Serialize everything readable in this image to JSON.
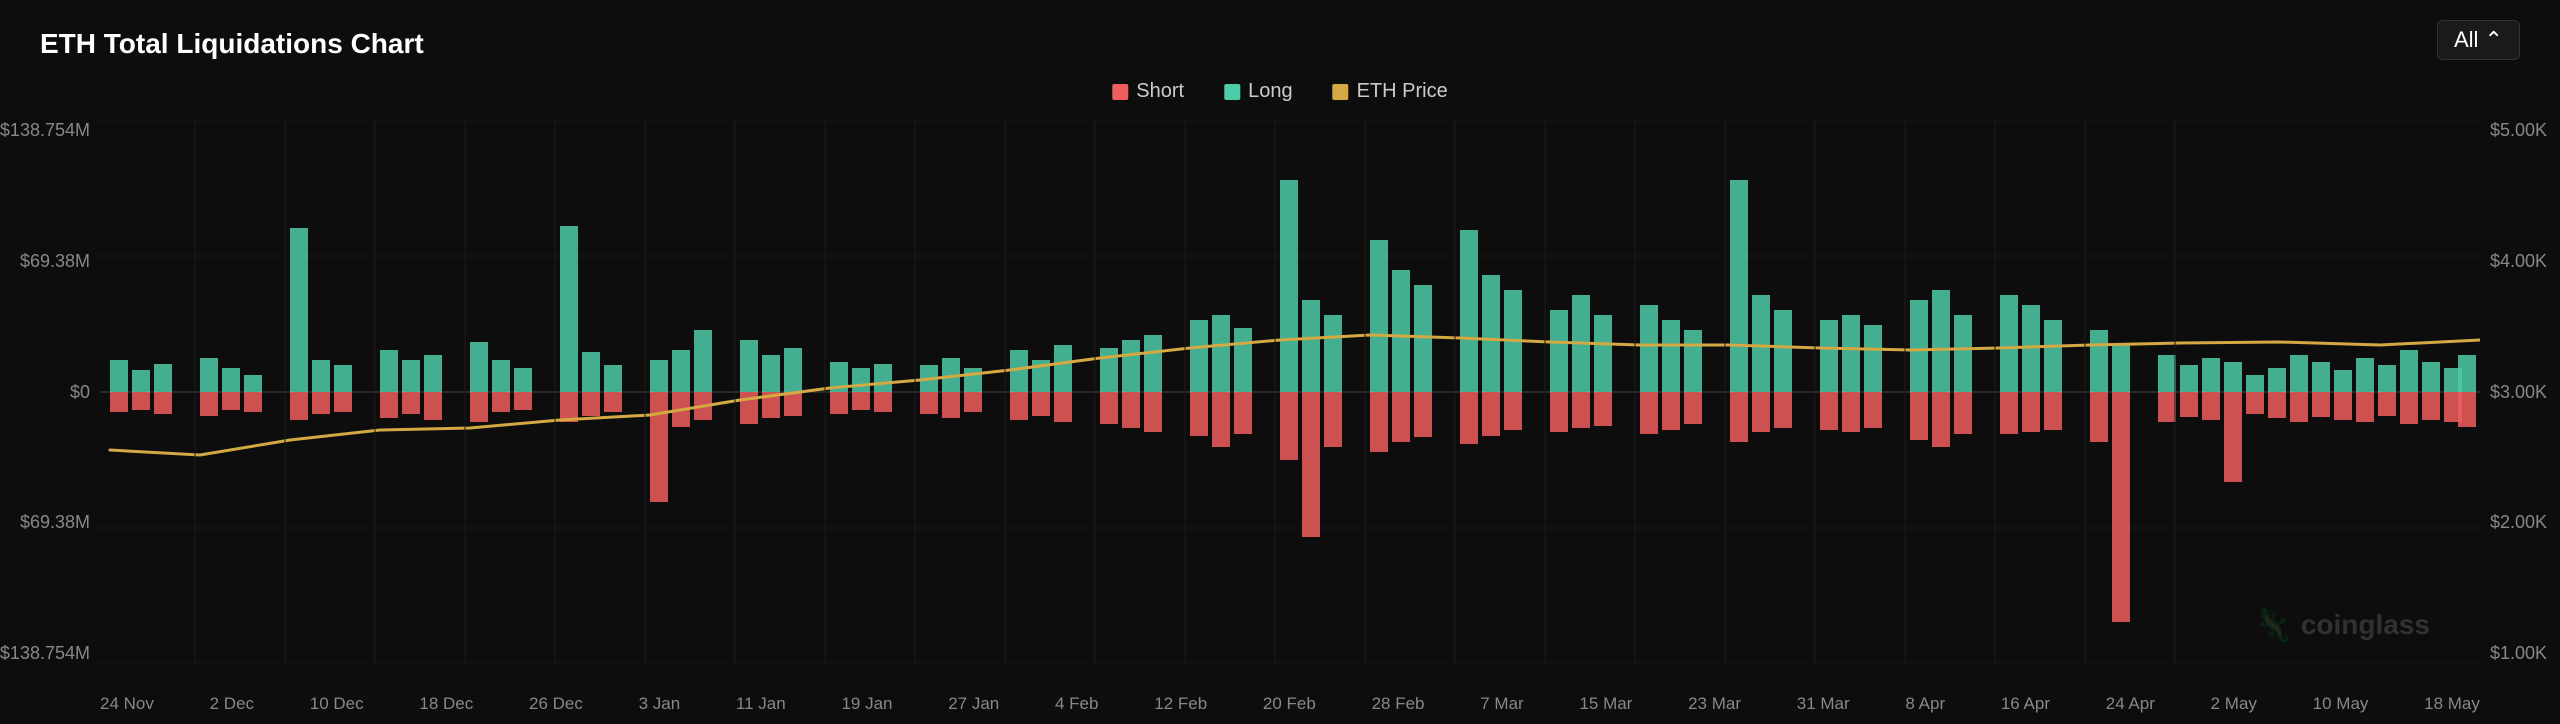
{
  "title": "ETH Total Liquidations Chart",
  "button": {
    "label": "All ⌃"
  },
  "legend": [
    {
      "label": "Short",
      "color": "#f05e5e"
    },
    {
      "label": "Long",
      "color": "#4ecba8"
    },
    {
      "label": "ETH Price",
      "color": "#d4a843"
    }
  ],
  "yAxisLeft": [
    "$138.754M",
    "$69.38M",
    "$0",
    "$69.38M",
    "$138.754M"
  ],
  "yAxisRight": [
    "$5.00K",
    "$4.00K",
    "$3.00K",
    "$2.00K",
    "$1.00K"
  ],
  "xLabels": [
    "24 Nov",
    "2 Dec",
    "10 Dec",
    "18 Dec",
    "26 Dec",
    "3 Jan",
    "11 Jan",
    "19 Jan",
    "27 Jan",
    "4 Feb",
    "12 Feb",
    "20 Feb",
    "28 Feb",
    "7 Mar",
    "15 Mar",
    "23 Mar",
    "31 Mar",
    "8 Apr",
    "16 Apr",
    "24 Apr",
    "2 May",
    "10 May",
    "18 May"
  ],
  "watermark": "coinglass",
  "colors": {
    "short": "#f05e5e",
    "long": "#4ecba8",
    "price": "#d4a843",
    "grid": "#222222",
    "background": "#0d0d0d"
  }
}
